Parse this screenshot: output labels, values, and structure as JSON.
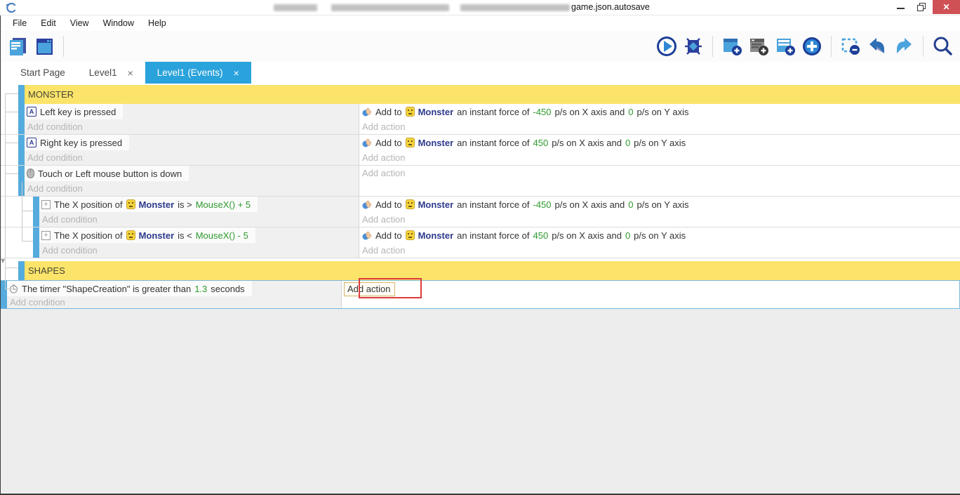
{
  "window": {
    "title_suffix": "game.json.autosave",
    "controls": {
      "close_glyph": "✕"
    }
  },
  "menu": {
    "items": [
      "File",
      "Edit",
      "View",
      "Window",
      "Help"
    ]
  },
  "toolbar": {
    "left_icons": [
      "project-manager",
      "scene-editor"
    ],
    "right_icons": [
      "preview-play",
      "debug-bug",
      "add-event",
      "add-comment",
      "add-subevent",
      "add-other-event",
      "delete-selection",
      "undo",
      "redo",
      "search"
    ]
  },
  "tabs": [
    {
      "label": "Start Page",
      "active": false
    },
    {
      "label": "Level1",
      "active": false,
      "close": "×"
    },
    {
      "label": "Level1 (Events)",
      "active": true,
      "close": "×"
    }
  ],
  "icons": {
    "keyboard_letter": "A",
    "position_cross": "+"
  },
  "events": {
    "collapse_arrow": "▾",
    "labels": {
      "add_condition": "Add condition",
      "add_action": "Add action"
    },
    "colors": {
      "group_bg": "#fbe469",
      "event_bar": "#55abdd",
      "object_text": "#2d3a8c",
      "value_text": "#2e9a2e",
      "active_tab": "#2aa2db",
      "annotation": "#dc3c3c"
    },
    "rows": [
      {
        "type": "group",
        "label": "MONSTER"
      },
      {
        "type": "event",
        "condition": {
          "icon": "keyboard-key-icon",
          "text": "Left key is pressed"
        },
        "action": {
          "icon": "force-hand-icon",
          "pre": "Add to",
          "object": "Monster",
          "mid": "an instant force of",
          "x_value": "-450",
          "between": "p/s on X axis and",
          "y_value": "0",
          "post": "p/s on Y axis"
        }
      },
      {
        "type": "event",
        "condition": {
          "icon": "keyboard-key-icon",
          "text": "Right key is pressed"
        },
        "action": {
          "icon": "force-hand-icon",
          "pre": "Add to",
          "object": "Monster",
          "mid": "an instant force of",
          "x_value": "450",
          "between": "p/s on X axis and",
          "y_value": "0",
          "post": "p/s on Y axis"
        }
      },
      {
        "type": "event",
        "condition": {
          "icon": "mouse-icon",
          "text": "Touch or Left mouse button is down"
        },
        "action": null
      },
      {
        "type": "event",
        "indent": 1,
        "condition": {
          "icon": "position-icon",
          "pre": "The X position of",
          "object": "Monster",
          "mid": "is >",
          "expr": "MouseX() + 5"
        },
        "action": {
          "icon": "force-hand-icon",
          "pre": "Add to",
          "object": "Monster",
          "mid": "an instant force of",
          "x_value": "-450",
          "between": "p/s on X axis and",
          "y_value": "0",
          "post": "p/s on Y axis"
        }
      },
      {
        "type": "event",
        "indent": 1,
        "condition": {
          "icon": "position-icon",
          "pre": "The X position of",
          "object": "Monster",
          "mid": "is <",
          "expr": "MouseX() - 5"
        },
        "action": {
          "icon": "force-hand-icon",
          "pre": "Add to",
          "object": "Monster",
          "mid": "an instant force of",
          "x_value": "450",
          "between": "p/s on X axis and",
          "y_value": "0",
          "post": "p/s on Y axis"
        }
      },
      {
        "type": "group",
        "label": "SHAPES"
      },
      {
        "type": "event",
        "selected": true,
        "condition": {
          "icon": "timer-icon",
          "pre": "The timer \"ShapeCreation\" is greater than",
          "value": "1.3",
          "post": "seconds"
        },
        "action": null
      }
    ]
  },
  "annotation": {
    "highlight_target": "add-action-button",
    "color": "#dc3c3c"
  }
}
